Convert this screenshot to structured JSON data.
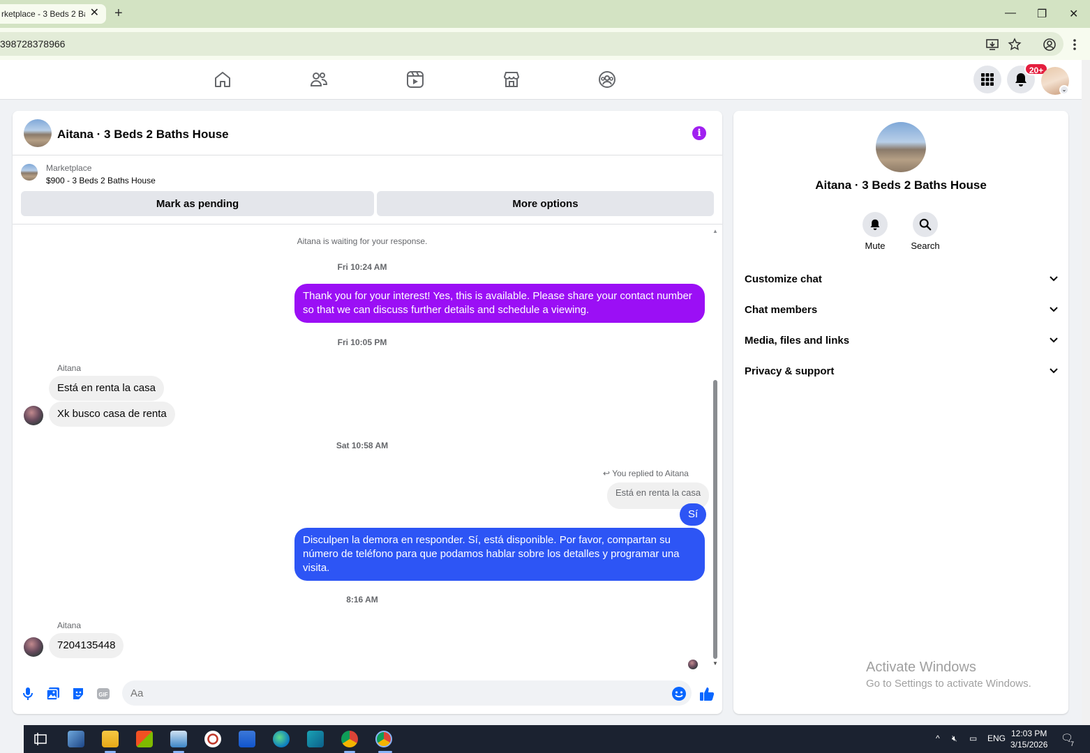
{
  "browser": {
    "tab_title": "rketplace - 3 Beds 2 Ba",
    "tab_close": "✕",
    "new_tab": "+",
    "url": "398728378966",
    "min": "—",
    "max": "❐",
    "close": "✕"
  },
  "header": {
    "notification_badge": "20+"
  },
  "chat": {
    "title": "Aitana · 3 Beds 2 Baths House",
    "marketplace_label": "Marketplace",
    "listing": "$900 - 3 Beds 2 Baths House",
    "mark_pending": "Mark as pending",
    "more_options": "More options",
    "waiting_notice": "Aitana is waiting for your response.",
    "messages": {
      "ts1": "Fri 10:24 AM",
      "out1": "Thank you for your interest! Yes, this is available. Please share your contact number so that we can discuss further details and schedule a viewing.",
      "ts2": "Fri 10:05 PM",
      "sender1": "Aitana",
      "in1": "Está en renta la casa",
      "in2": "Xk busco casa de renta",
      "ts3": "Sat 10:58 AM",
      "reply_note": "You replied to Aitana",
      "quoted": "Está en renta la casa",
      "out2": "Sí",
      "out3": "Disculpen la demora en responder. Sí, está disponible. Por favor, compartan su número de teléfono para que podamos hablar sobre los detalles y programar una visita.",
      "ts4": "8:16 AM",
      "sender2": "Aitana",
      "in3": "7204135448"
    },
    "composer_placeholder": "Aa"
  },
  "side": {
    "title": "Aitana · 3 Beds 2 Baths House",
    "mute": "Mute",
    "search": "Search",
    "sections": [
      "Customize chat",
      "Chat members",
      "Media, files and links",
      "Privacy & support"
    ],
    "activate_title": "Activate Windows",
    "activate_sub": "Go to Settings to activate Windows."
  },
  "taskbar": {
    "lang": "ENG",
    "time": "12:03 PM",
    "date": "3/15/2026",
    "notif_count": "7"
  },
  "colors": {
    "purple_bubble": "#9b0ff5",
    "blue_bubble": "#2d55f5",
    "fb_blue": "#0866ff"
  }
}
